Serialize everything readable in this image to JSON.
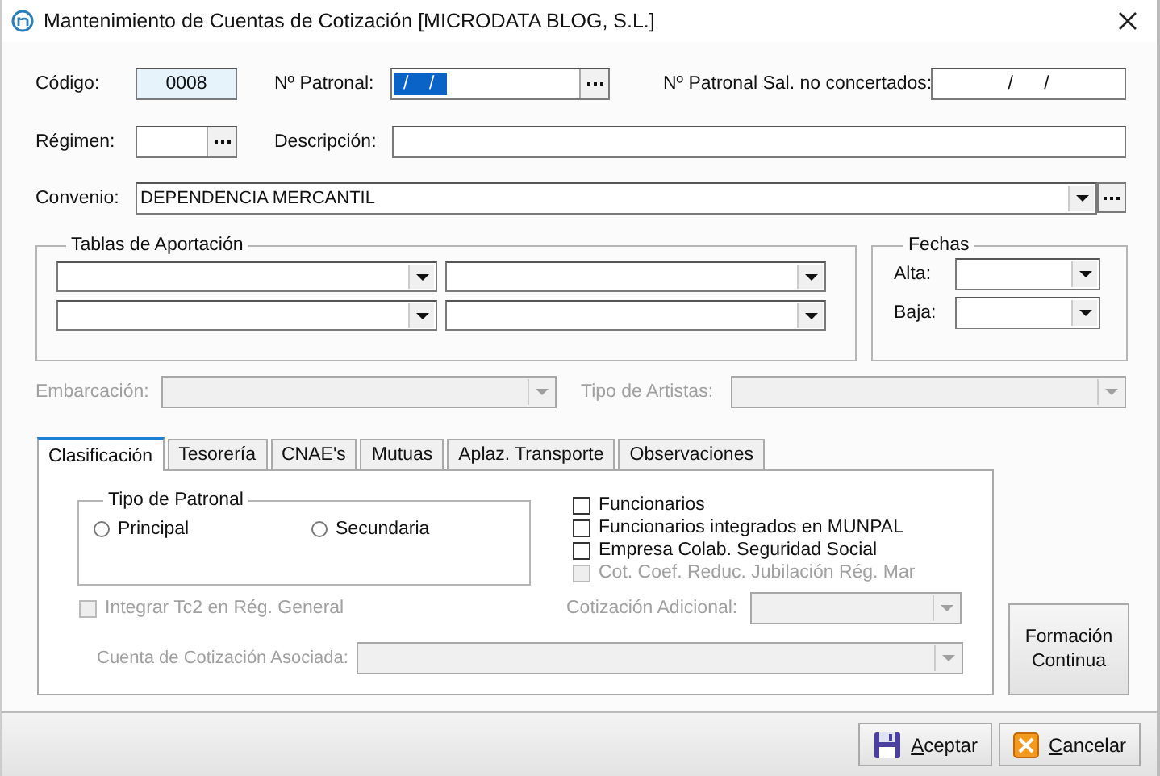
{
  "window": {
    "title": "Mantenimiento de Cuentas de Cotización [MICRODATA BLOG, S.L.]"
  },
  "codigo": {
    "label": "Código:",
    "value": "0008"
  },
  "patronal": {
    "label": "Nº Patronal:",
    "value": "/    /",
    "selected": true
  },
  "patronal_sal": {
    "label": "Nº Patronal Sal. no concertados:",
    "value": "/      /"
  },
  "regimen": {
    "label": "Régimen:"
  },
  "descripcion": {
    "label": "Descripción:"
  },
  "convenio": {
    "label": "Convenio:",
    "value": "DEPENDENCIA MERCANTIL"
  },
  "tablas": {
    "title": "Tablas de Aportación",
    "combos": [
      {
        "disabled": false
      },
      {
        "disabled": false
      },
      {
        "disabled": false
      },
      {
        "disabled": false
      }
    ]
  },
  "fechas": {
    "title": "Fechas",
    "fields": [
      {
        "label": "Alta:",
        "disabled": false
      },
      {
        "label": "Baja:",
        "disabled": false
      }
    ]
  },
  "embarcacion": {
    "label": "Embarcación:",
    "disabled": true
  },
  "tipo_artistas": {
    "label": "Tipo de Artistas:",
    "disabled": true
  },
  "tabs": [
    {
      "label": "Clasificación",
      "selected": true
    },
    {
      "label": "Tesorería",
      "selected": false
    },
    {
      "label": "CNAE's",
      "selected": false
    },
    {
      "label": "Mutuas",
      "selected": false
    },
    {
      "label": "Aplaz. Transporte",
      "selected": false
    },
    {
      "label": "Observaciones",
      "selected": false
    }
  ],
  "tipo_patronal": {
    "title": "Tipo de Patronal",
    "options": [
      {
        "label": "Principal",
        "selected": false
      },
      {
        "label": "Secundaria",
        "selected": false
      }
    ]
  },
  "checks": [
    {
      "label": "Funcionarios",
      "checked": false,
      "disabled": false
    },
    {
      "label": "Funcionarios integrados en MUNPAL",
      "checked": false,
      "disabled": false
    },
    {
      "label": "Empresa Colab. Seguridad Social",
      "checked": false,
      "disabled": false
    },
    {
      "label": "Cot. Coef. Reduc. Jubilación Rég. Mar",
      "checked": false,
      "disabled": true
    }
  ],
  "integrar": {
    "label": "Integrar Tc2 en Rég. General",
    "checked": false,
    "disabled": true
  },
  "cotizacion_adicional": {
    "label": "Cotización Adicional:",
    "disabled": true
  },
  "cuenta_asociada": {
    "label": "Cuenta de Cotización Asociada:",
    "disabled": true
  },
  "formacion_button": {
    "label": "Formación Continua"
  },
  "buttons": [
    {
      "label": "Aceptar",
      "kind": "save"
    },
    {
      "label": "Cancelar",
      "kind": "cancel"
    }
  ]
}
